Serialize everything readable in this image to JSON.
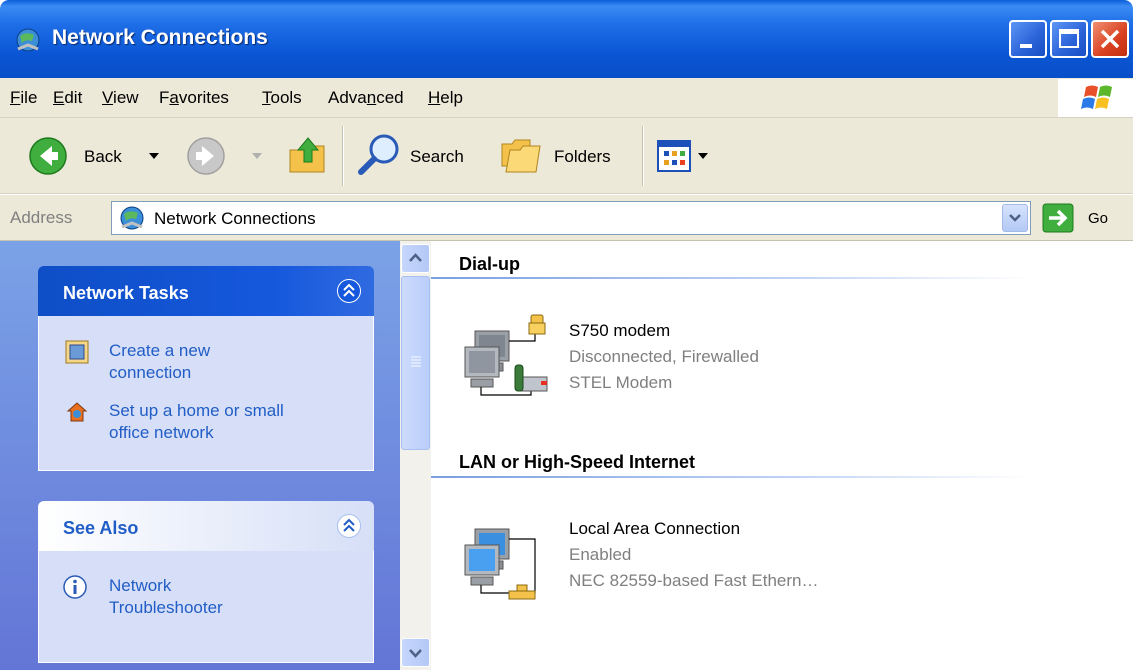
{
  "window": {
    "title": "Network Connections"
  },
  "menu": [
    {
      "pre": "",
      "ul": "F",
      "post": "ile"
    },
    {
      "pre": "",
      "ul": "E",
      "post": "dit"
    },
    {
      "pre": "",
      "ul": "V",
      "post": "iew"
    },
    {
      "pre": "F",
      "ul": "a",
      "post": "vorites"
    },
    {
      "pre": "",
      "ul": "T",
      "post": "ools"
    },
    {
      "pre": "Adva",
      "ul": "n",
      "post": "ced"
    },
    {
      "pre": "",
      "ul": "H",
      "post": "elp"
    }
  ],
  "toolbar": {
    "back_label": "Back",
    "search_label": "Search",
    "folders_label": "Folders"
  },
  "address": {
    "label": "Address",
    "value": "Network Connections",
    "go_label": "Go"
  },
  "network_tasks": {
    "header": "Network Tasks",
    "items": [
      {
        "line1": "Create a new",
        "line2": "connection",
        "icon": "new-connection-icon"
      },
      {
        "line1": "Set up a home or small",
        "line2": "office network",
        "icon": "home-network-icon"
      }
    ]
  },
  "see_also": {
    "header": "See Also",
    "items": [
      {
        "line1": "Network",
        "line2": "Troubleshooter",
        "icon": "info-icon"
      }
    ]
  },
  "groups": {
    "dialup": {
      "header": "Dial-up",
      "connection": {
        "name": "S750 modem",
        "status": "Disconnected, Firewalled",
        "device": "STEL Modem"
      }
    },
    "lan": {
      "header": "LAN or High-Speed Internet",
      "connection": {
        "name": "Local Area Connection",
        "status": "Enabled",
        "device": "NEC 82559-based Fast Ethern…"
      }
    }
  },
  "colors": {
    "titlebar": "#0a55d4",
    "taskpane": "#7ba2e7",
    "link": "#215dc6",
    "chrome": "#ece9d8"
  }
}
